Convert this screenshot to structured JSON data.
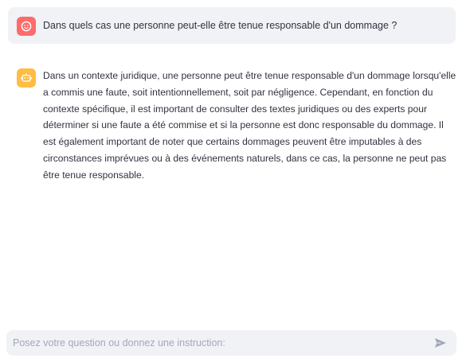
{
  "conversation": {
    "user_message": {
      "avatar_icon": "user-face-icon",
      "avatar_color": "#ff6b6b",
      "text": "Dans quels cas une personne peut-elle être tenue responsable d'un dommage ?"
    },
    "assistant_message": {
      "avatar_icon": "robot-icon",
      "avatar_color": "#ffbd45",
      "text": "Dans un contexte juridique, une personne peut être tenue responsable d'un dommage lorsqu'elle a commis une faute, soit intentionnellement, soit par négligence. Cependant, en fonction du contexte spécifique, il est important de consulter des textes juridiques ou des experts pour déterminer si une faute a été commise et si la personne est donc responsable du dommage. Il est également important de noter que certains dommages peuvent être imputables à des circonstances imprévues ou à des événements naturels, dans ce cas, la personne ne peut pas être tenue responsable."
    }
  },
  "chat_input": {
    "placeholder": "Posez votre question ou donnez une instruction:",
    "value": "",
    "send_icon": "send-icon"
  },
  "colors": {
    "bubble_background": "#f0f2f6",
    "text": "#31333f",
    "placeholder": "#a3a8b8"
  }
}
